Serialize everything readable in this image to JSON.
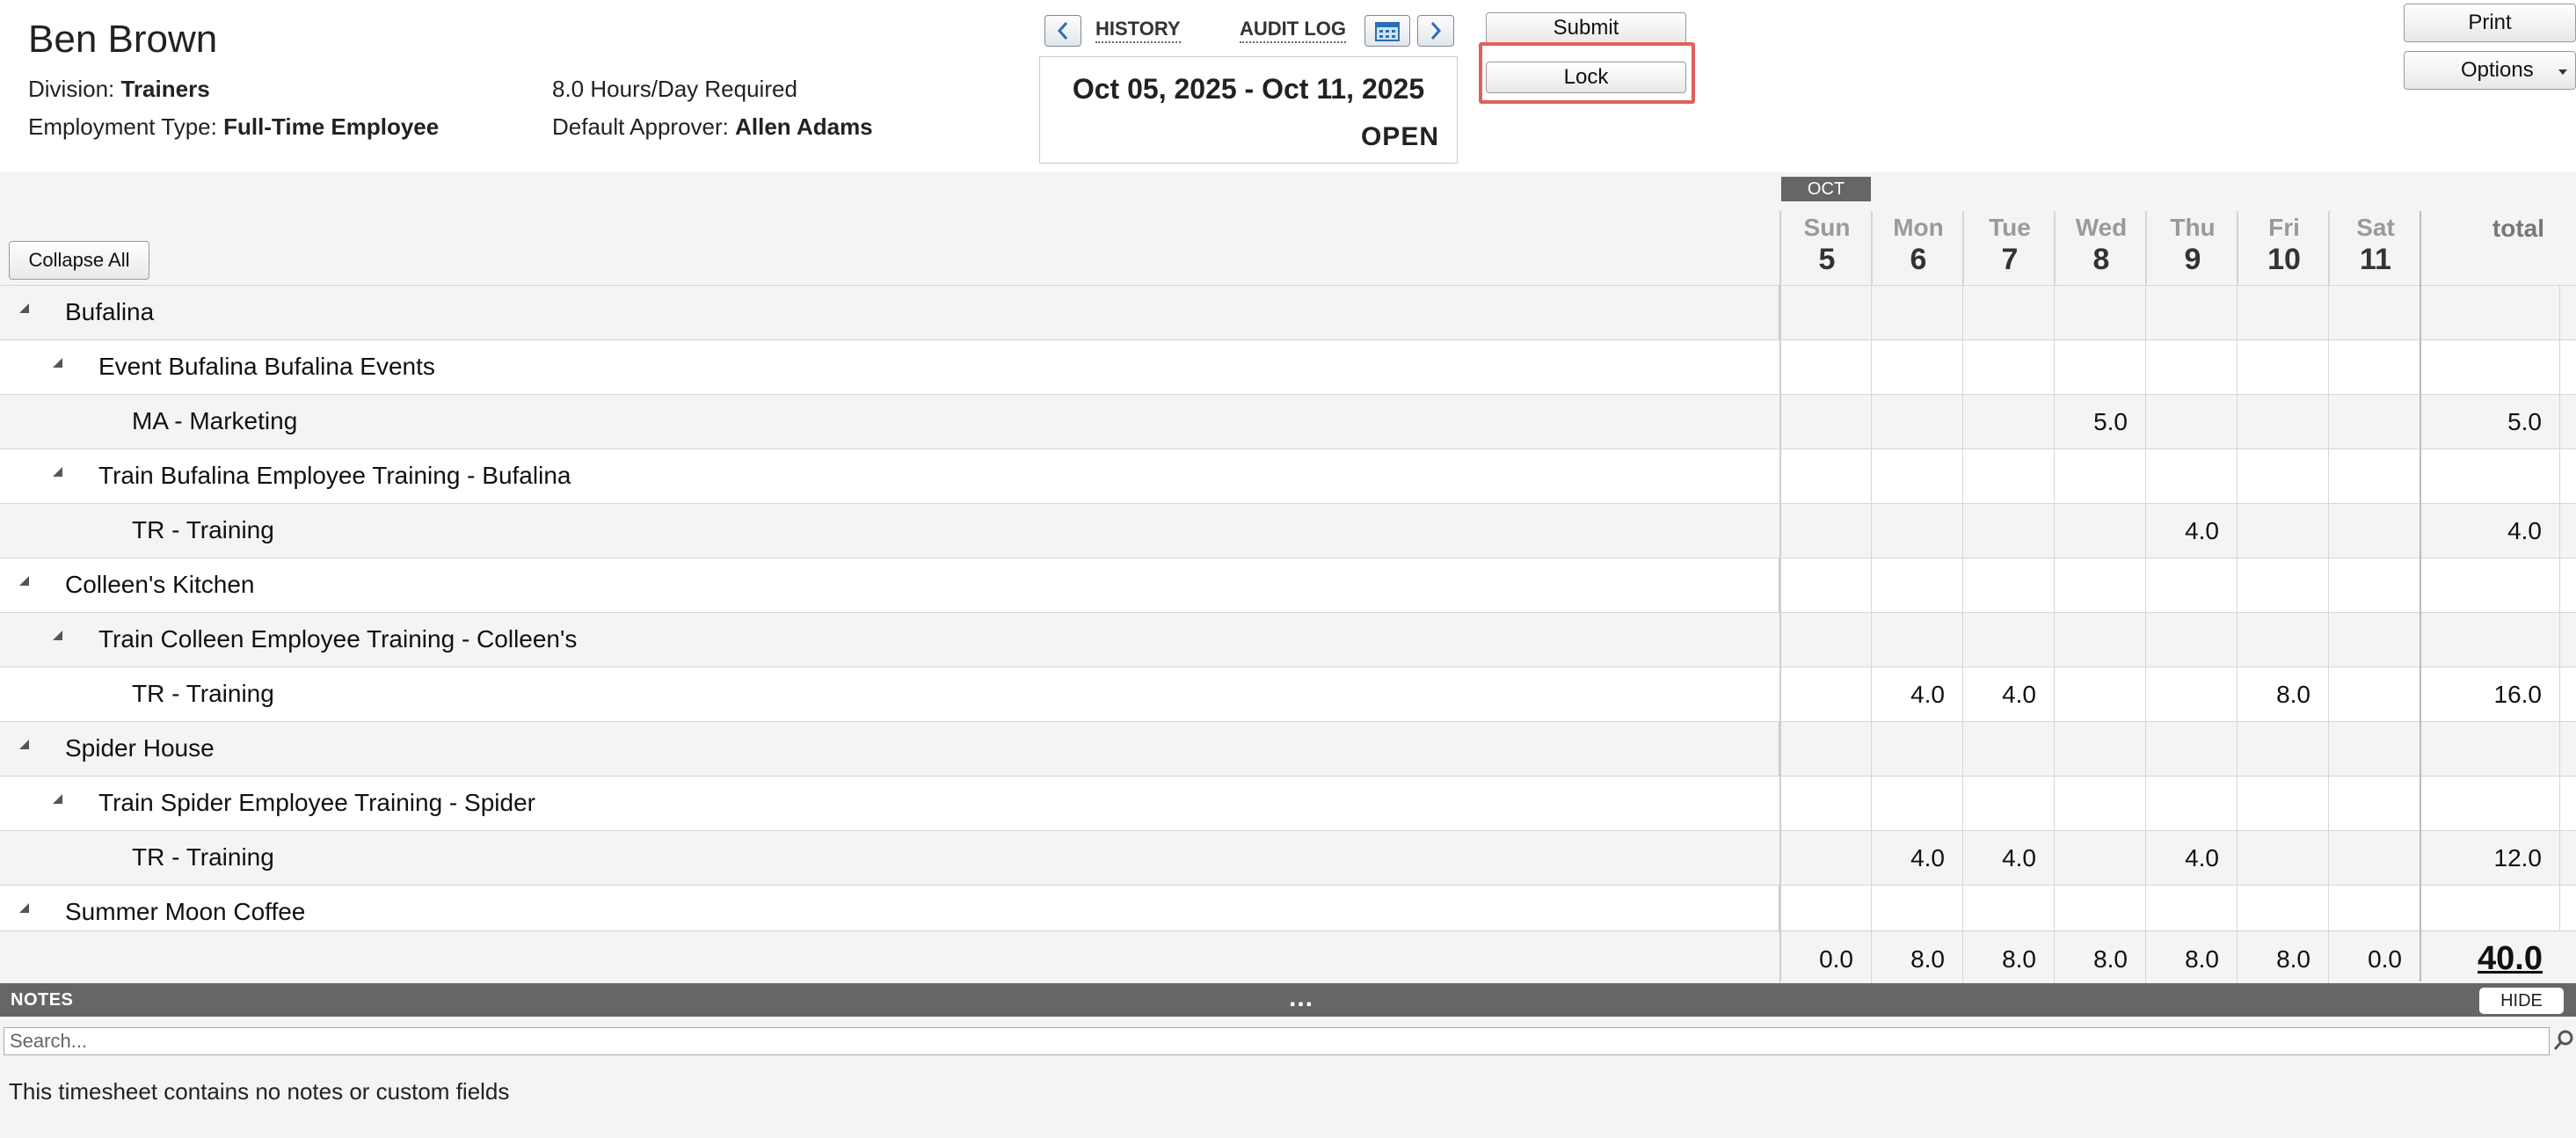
{
  "employee": {
    "name": "Ben Brown",
    "division_label": "Division:",
    "division": "Trainers",
    "employment_label": "Employment Type:",
    "employment_type": "Full-Time Employee",
    "hours_required": "8.0 Hours/Day Required",
    "approver_label": "Default Approver:",
    "approver": "Allen Adams"
  },
  "nav": {
    "history": "HISTORY",
    "audit_log": "AUDIT LOG"
  },
  "period": {
    "range": "Oct 05, 2025 - Oct 11, 2025",
    "status": "OPEN"
  },
  "buttons": {
    "submit": "Submit",
    "lock": "Lock",
    "print": "Print",
    "options": "Options",
    "collapse_all": "Collapse All",
    "hide": "HIDE"
  },
  "grid": {
    "month": "OCT",
    "total_label": "total",
    "days": [
      {
        "name": "Sun",
        "num": "5"
      },
      {
        "name": "Mon",
        "num": "6"
      },
      {
        "name": "Tue",
        "num": "7"
      },
      {
        "name": "Wed",
        "num": "8"
      },
      {
        "name": "Thu",
        "num": "9"
      },
      {
        "name": "Fri",
        "num": "10"
      },
      {
        "name": "Sat",
        "num": "11"
      }
    ],
    "rows": [
      {
        "label": "Bufalina",
        "level": 0,
        "values": [
          "",
          "",
          "",
          "",
          "",
          "",
          ""
        ],
        "total": ""
      },
      {
        "label": "Event Bufalina Bufalina Events",
        "level": 1,
        "values": [
          "",
          "",
          "",
          "",
          "",
          "",
          ""
        ],
        "total": ""
      },
      {
        "label": "MA - Marketing",
        "level": 2,
        "values": [
          "",
          "",
          "",
          "5.0",
          "",
          "",
          ""
        ],
        "total": "5.0"
      },
      {
        "label": "Train Bufalina Employee Training - Bufalina",
        "level": 1,
        "values": [
          "",
          "",
          "",
          "",
          "",
          "",
          ""
        ],
        "total": ""
      },
      {
        "label": "TR - Training",
        "level": 2,
        "values": [
          "",
          "",
          "",
          "",
          "4.0",
          "",
          ""
        ],
        "total": "4.0"
      },
      {
        "label": "Colleen's Kitchen",
        "level": 0,
        "values": [
          "",
          "",
          "",
          "",
          "",
          "",
          ""
        ],
        "total": ""
      },
      {
        "label": "Train Colleen Employee Training - Colleen's",
        "level": 1,
        "values": [
          "",
          "",
          "",
          "",
          "",
          "",
          ""
        ],
        "total": ""
      },
      {
        "label": "TR - Training",
        "level": 2,
        "values": [
          "",
          "4.0",
          "4.0",
          "",
          "",
          "8.0",
          ""
        ],
        "total": "16.0"
      },
      {
        "label": "Spider House",
        "level": 0,
        "values": [
          "",
          "",
          "",
          "",
          "",
          "",
          ""
        ],
        "total": ""
      },
      {
        "label": "Train Spider Employee Training - Spider",
        "level": 1,
        "values": [
          "",
          "",
          "",
          "",
          "",
          "",
          ""
        ],
        "total": ""
      },
      {
        "label": "TR - Training",
        "level": 2,
        "values": [
          "",
          "4.0",
          "4.0",
          "",
          "4.0",
          "",
          ""
        ],
        "total": "12.0"
      },
      {
        "label": "Summer Moon Coffee",
        "level": 0,
        "values": [
          "",
          "",
          "",
          "",
          "",
          "",
          ""
        ],
        "total": ""
      }
    ],
    "day_totals": [
      "0.0",
      "8.0",
      "8.0",
      "8.0",
      "8.0",
      "8.0",
      "0.0"
    ],
    "grand_total": "40.0"
  },
  "notes": {
    "title": "NOTES",
    "dots": "...",
    "search_placeholder": "Search...",
    "empty_message": "This timesheet contains no notes or custom fields"
  }
}
